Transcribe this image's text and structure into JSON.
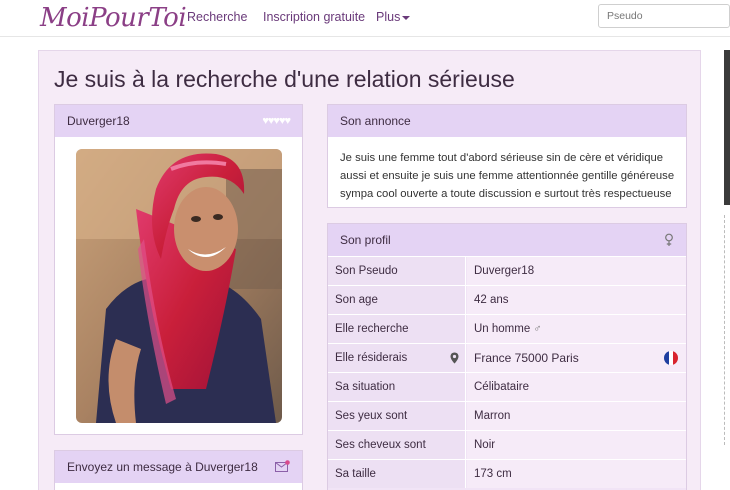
{
  "navbar": {
    "logo": "MoiPourToi",
    "links": [
      "Recherche",
      "Inscription gratuite",
      "Plus"
    ],
    "search_placeholder": "Pseudo"
  },
  "page_title": "Je suis à la recherche d'une relation sérieuse",
  "photo_panel": {
    "username": "Duverger18",
    "hearts": "♥♥♥♥♥"
  },
  "message_panel": {
    "label": "Envoyez un message à Duverger18"
  },
  "annonce": {
    "title": "Son annonce",
    "text": "Je suis une femme tout d'abord sérieuse sin de cère et véridique aussi et ensuite je suis une femme attentionnée gentille généreuse sympa cool ouverte a toute discussion e surtout très respectueuse"
  },
  "profil": {
    "title": "Son profil",
    "rows": [
      {
        "label": "Son Pseudo",
        "value": "Duverger18"
      },
      {
        "label": "Son age",
        "value": "42 ans"
      },
      {
        "label": "Elle recherche",
        "value": "Un homme"
      },
      {
        "label": "Elle résiderais",
        "value": "France 75000 Paris"
      },
      {
        "label": "Sa situation",
        "value": "Célibataire"
      },
      {
        "label": "Ses yeux sont",
        "value": "Marron"
      },
      {
        "label": "Ses cheveux sont",
        "value": "Noir"
      },
      {
        "label": "Sa taille",
        "value": "173 cm"
      }
    ],
    "male_symbol": "♂"
  },
  "colors": {
    "brand": "#8b3f86",
    "panel_header": "#e4d3f4",
    "page_bg": "#f6ebf7"
  }
}
